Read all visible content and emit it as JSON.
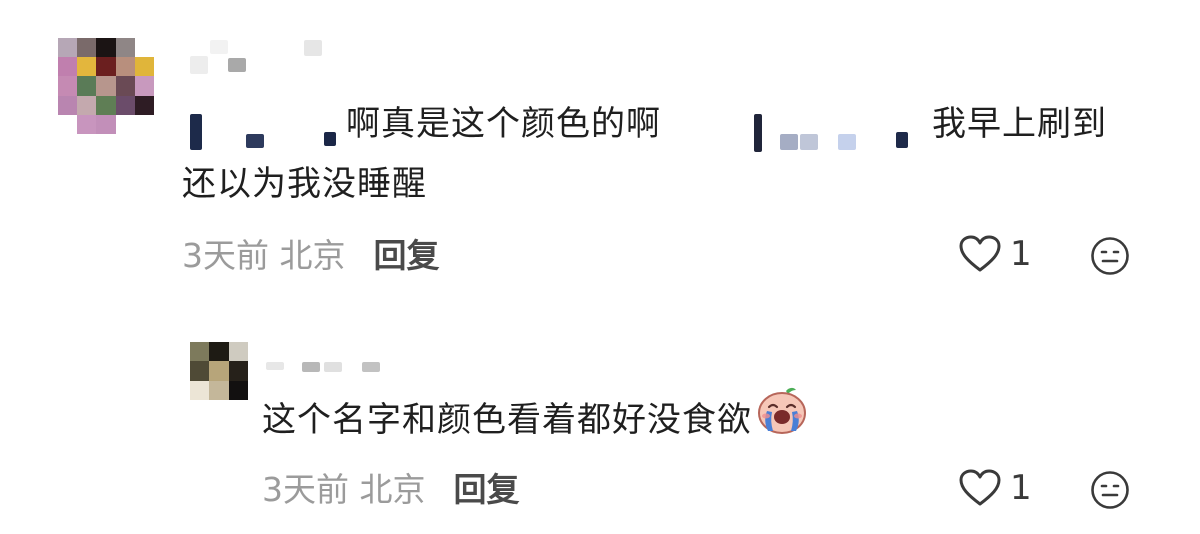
{
  "comments": [
    {
      "line1_text": "啊真是这个颜色的啊",
      "line1_tail": "我早上刷到",
      "line2_text": "还以为我没睡醒",
      "time_location": "3天前 北京",
      "reply_label": "回复",
      "like_count": "1"
    },
    {
      "text": "这个名字和颜色看着都好没食欲",
      "emoji": "crying-face-sticker-icon",
      "time_location": "3天前 北京",
      "reply_label": "回复",
      "like_count": "1"
    }
  ],
  "colors": {
    "heart_outline": "#3a3a3a",
    "meta_gray": "#9b9b9b",
    "reply_dark": "#4a4a4a"
  }
}
